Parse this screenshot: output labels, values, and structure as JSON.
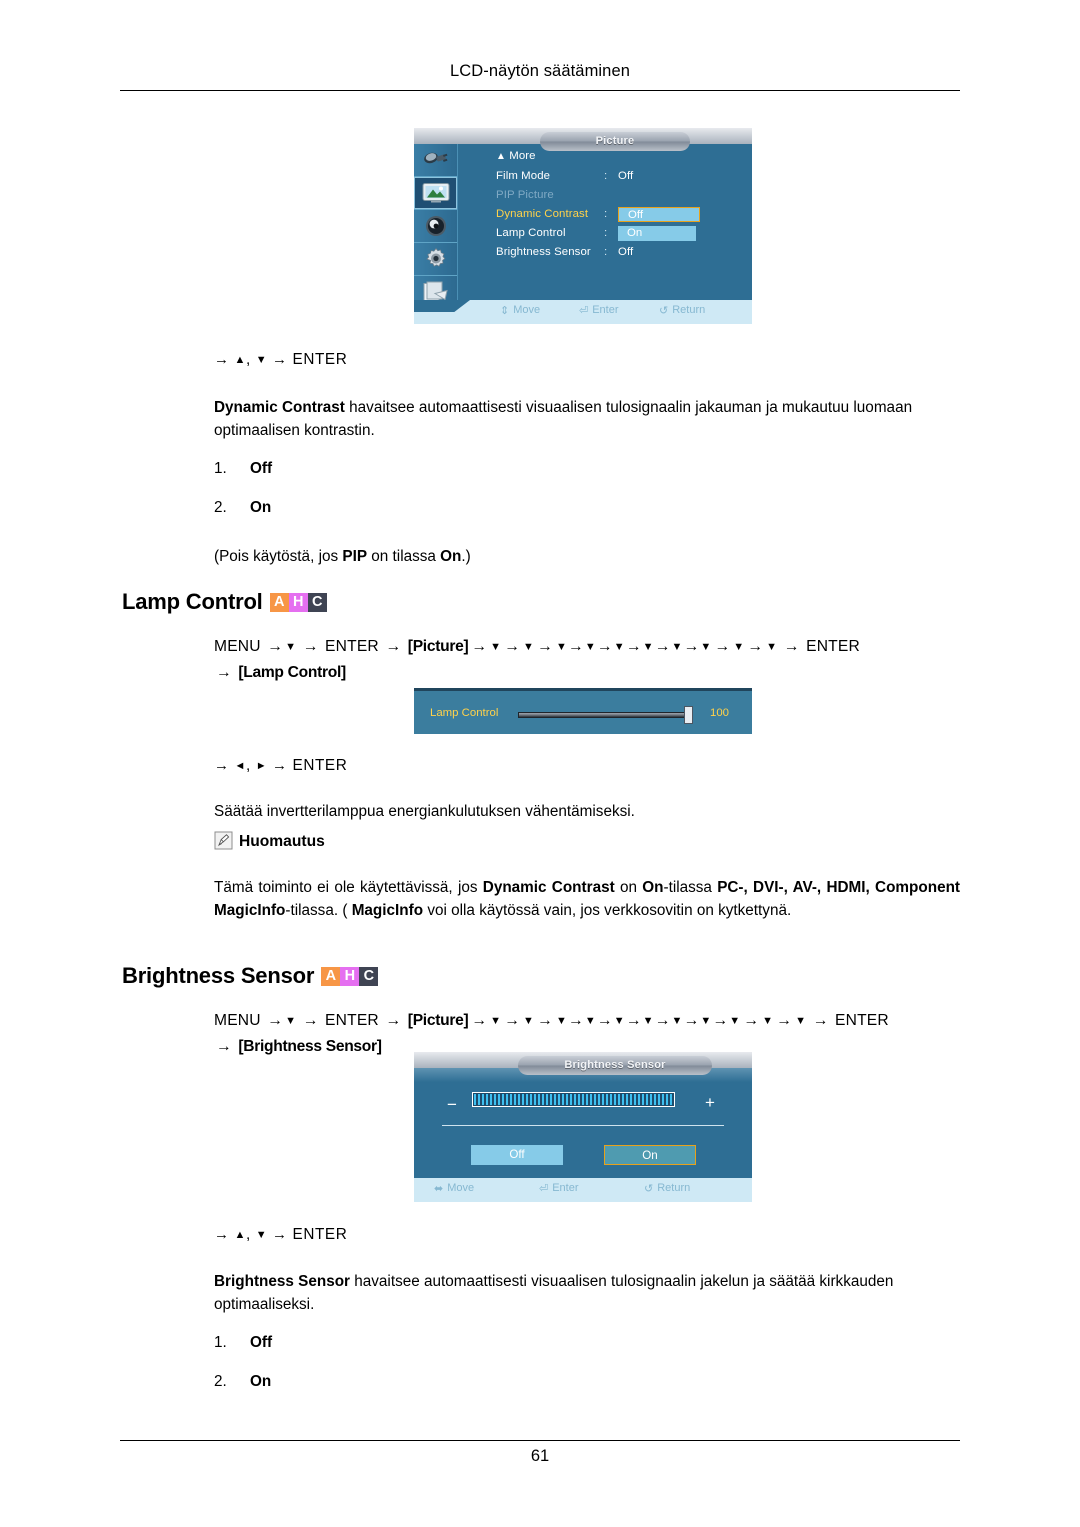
{
  "document": {
    "running_head": "LCD-näytön säätäminen",
    "page_number": "61"
  },
  "osd_picture": {
    "title": "Picture",
    "rows": [
      {
        "label": "More",
        "value": "",
        "state": "more"
      },
      {
        "label": "Film Mode",
        "value": "Off",
        "state": "normal"
      },
      {
        "label": "PIP Picture",
        "value": "",
        "state": "disabled"
      },
      {
        "label": "Dynamic Contrast",
        "value": "Off",
        "state": "highlighted"
      },
      {
        "label": "Lamp Control",
        "value": "On",
        "state": "normal"
      },
      {
        "label": "Brightness Sensor",
        "value": "Off",
        "state": "normal"
      }
    ],
    "colon": ":",
    "rail_icons": [
      "input-source-icon",
      "picture-icon",
      "sound-icon",
      "setup-gear-icon",
      "multi-control-icon"
    ],
    "footer": {
      "move": "Move",
      "enter": "Enter",
      "return": "Return"
    }
  },
  "section_dynamic_contrast": {
    "key_line_prefix": "→",
    "key_line_up": "▲",
    "key_line_comma": ",",
    "key_line_down": "▼",
    "key_line_arrow": "→",
    "key_line_enter": "ENTER",
    "description_bold": "Dynamic Contrast",
    "description_rest": " havaitsee automaattisesti visuaalisen tulosignaalin jakauman ja mukautuu luomaan optimaalisen kontrastin.",
    "options": [
      {
        "number": "1.",
        "label": "Off"
      },
      {
        "number": "2.",
        "label": "On"
      }
    ],
    "note_prefix": "(Pois käytöstä, jos ",
    "note_bold_1": "PIP",
    "note_mid": " on tilassa ",
    "note_bold_2": "On",
    "note_suffix": ".)"
  },
  "section_lamp_control": {
    "heading": "Lamp Control",
    "badges": [
      "A",
      "H",
      "C"
    ],
    "path": {
      "menu": "MENU",
      "enter": "ENTER",
      "picture_token": "[Picture]",
      "target_token": "[Lamp Control]",
      "arrow": "→",
      "down": "▼",
      "down_count_after_picture": 10
    },
    "key_line": {
      "arrow": "→",
      "left": "◄",
      "comma": ",",
      "right": "►",
      "enter": "ENTER"
    },
    "description": "Säätää invertterilamppua energiankulutuksen vähentämiseksi.",
    "note_label": "Huomautus",
    "note_segments": [
      {
        "text": "Tämä toiminto ei ole käytettävissä, jos ",
        "bold": false
      },
      {
        "text": "Dynamic Contrast",
        "bold": true
      },
      {
        "text": " on ",
        "bold": false
      },
      {
        "text": "On",
        "bold": true
      },
      {
        "text": "-tilassa ",
        "bold": false
      },
      {
        "text": "PC-, DVI-, AV-, HDMI, Component MagicInfo",
        "bold": true
      },
      {
        "text": "-tilassa. ( ",
        "bold": false
      },
      {
        "text": "MagicInfo",
        "bold": true
      },
      {
        "text": " voi olla käytössä vain, jos verkkosovitin on kytkettynä.",
        "bold": false
      }
    ]
  },
  "osd_lamp": {
    "label": "Lamp Control",
    "value": "100",
    "slider_percent": 100
  },
  "section_brightness_sensor": {
    "heading": "Brightness Sensor",
    "badges": [
      "A",
      "H",
      "C"
    ],
    "path": {
      "menu": "MENU",
      "enter": "ENTER",
      "picture_token": "[Picture]",
      "target_token": "[Brightness Sensor]",
      "arrow": "→",
      "down": "▼",
      "down_count_after_picture": 11
    },
    "key_line": {
      "arrow": "→",
      "up": "▲",
      "comma": ",",
      "down": "▼",
      "enter": "ENTER"
    },
    "description_bold": "Brightness Sensor",
    "description_rest": " havaitsee automaattisesti visuaalisen tulosignaalin jakelun ja säätää kirkkauden optimaaliseksi.",
    "options": [
      {
        "number": "1.",
        "label": "Off"
      },
      {
        "number": "2.",
        "label": "On"
      }
    ]
  },
  "osd_brightness_sensor": {
    "title": "Brightness Sensor",
    "minus": "−",
    "plus": "+",
    "buttons": {
      "off": "Off",
      "on": "On"
    },
    "selected_button": "On",
    "footer": {
      "move": "Move",
      "enter": "Enter",
      "return": "Return"
    }
  },
  "colors": {
    "osd_blue": "#2e6e94",
    "osd_cyan": "#86cbe8",
    "osd_highlight_yellow": "#ffd24a",
    "osd_select_border": "#e8a21b",
    "badge_a": "#f79646",
    "badge_h": "#e56ff0",
    "badge_c": "#3f4453"
  }
}
